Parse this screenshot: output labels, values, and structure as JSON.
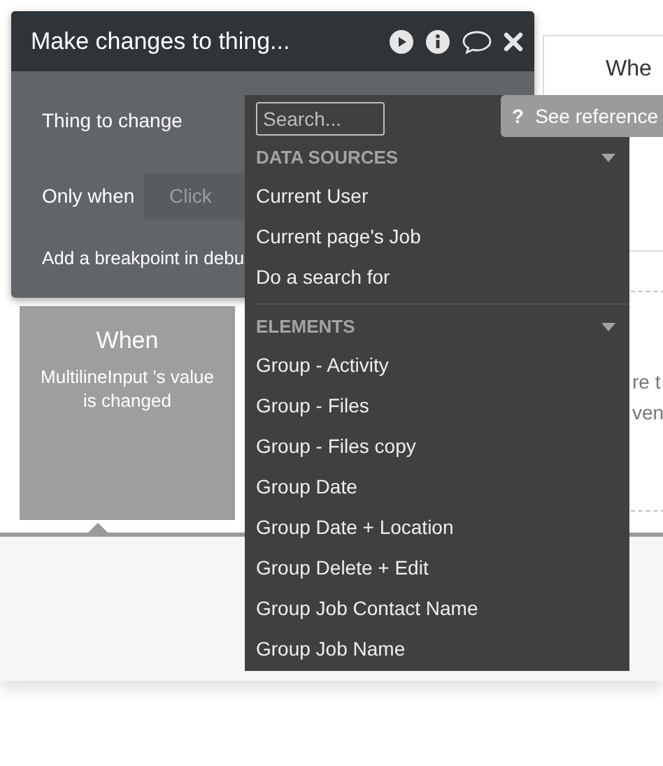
{
  "action_panel": {
    "title": "Make changes to thing...",
    "thing_label": "Thing to change",
    "condition_label": "Only when",
    "condition_placeholder": "Click",
    "breakpoint_label": "Add a breakpoint in debu"
  },
  "event_card": {
    "title": "When",
    "description": "MultilineInput 's value is changed"
  },
  "background_card": {
    "title": "Whe",
    "text_lines": [
      "re t",
      "ven"
    ]
  },
  "dropdown": {
    "search_placeholder": "Search...",
    "sections": [
      {
        "heading": "DATA SOURCES",
        "expanded": true,
        "items": [
          "Current User",
          "Current page's Job",
          "Do a search for"
        ]
      },
      {
        "heading": "ELEMENTS",
        "expanded": true,
        "items": [
          "Group - Activity",
          "Group - Files",
          "Group - Files copy",
          "Group Date",
          "Group Date + Location",
          "Group Delete + Edit",
          "Group Job Contact Name",
          "Group Job Name"
        ]
      }
    ]
  },
  "tooltip": {
    "icon": "?",
    "label": "See reference"
  }
}
